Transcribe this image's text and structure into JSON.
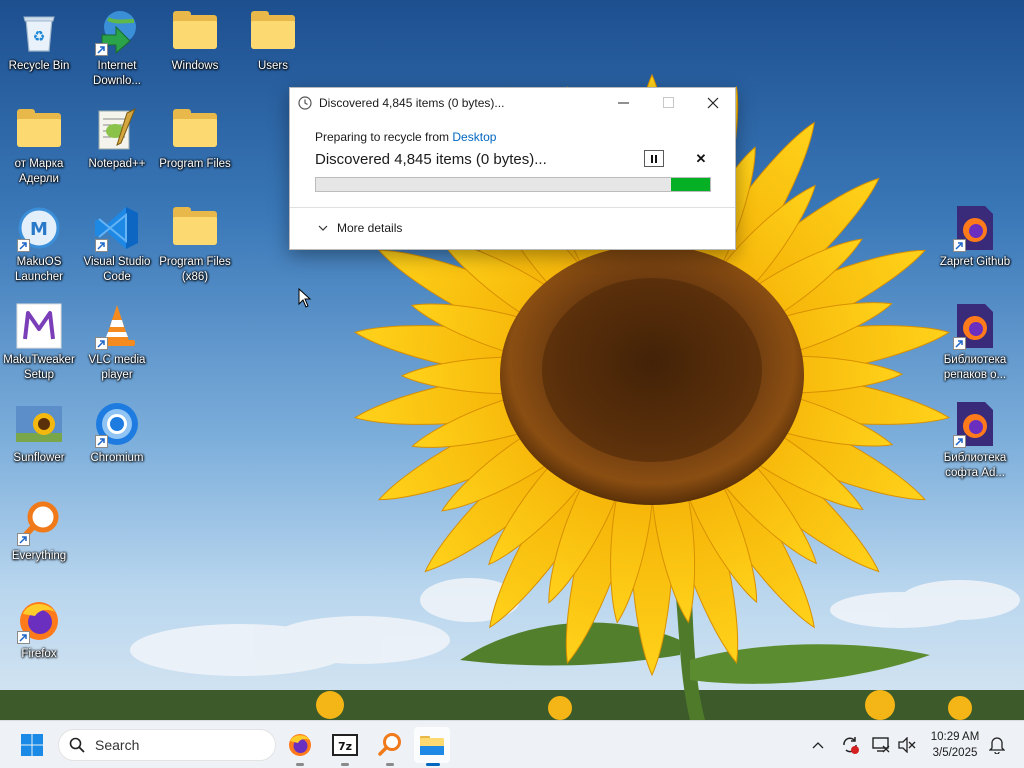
{
  "desktop": {
    "icons": [
      {
        "label": "Recycle Bin",
        "icon": "recycle-bin-icon"
      },
      {
        "label": "Internet Downlo...",
        "icon": "internet-download-manager-icon"
      },
      {
        "label": "Windows",
        "icon": "folder-icon"
      },
      {
        "label": "Users",
        "icon": "folder-icon"
      },
      {
        "label": "от Марка Адерли",
        "icon": "folder-icon"
      },
      {
        "label": "Notepad++",
        "icon": "notepad-plus-plus-icon"
      },
      {
        "label": "Program Files",
        "icon": "folder-icon"
      },
      {
        "label": "MakuOS Launcher",
        "icon": "makuos-launcher-icon"
      },
      {
        "label": "Visual Studio Code",
        "icon": "vscode-icon"
      },
      {
        "label": "Program Files (x86)",
        "icon": "folder-icon"
      },
      {
        "label": "MakuTweaker Setup",
        "icon": "makutweaker-icon"
      },
      {
        "label": "VLC media player",
        "icon": "vlc-icon"
      },
      {
        "label": "Sunflower",
        "icon": "image-thumbnail-icon"
      },
      {
        "label": "Chromium",
        "icon": "chromium-icon"
      },
      {
        "label": "Everything",
        "icon": "everything-search-icon"
      },
      {
        "label": "Firefox",
        "icon": "firefox-icon"
      },
      {
        "label": "Zapret Github",
        "icon": "firefox-shortcut-icon"
      },
      {
        "label": "Библиотека репаков о...",
        "icon": "firefox-shortcut-icon"
      },
      {
        "label": "Библиотека софта Ad...",
        "icon": "firefox-shortcut-icon"
      }
    ]
  },
  "dialog": {
    "title": "Discovered 4,845 items (0 bytes)...",
    "preparing_prefix": "Preparing to recycle from ",
    "preparing_location": "Desktop",
    "status": "Discovered 4,845 items (0 bytes)...",
    "progress_fraction": 0.1,
    "more_details": "More details"
  },
  "taskbar": {
    "search_placeholder": "Search",
    "pinned": [
      "firefox-icon",
      "7zip-icon",
      "everything-search-icon",
      "file-explorer-icon"
    ],
    "active_app": "file-explorer-icon",
    "time": "10:29 AM",
    "date": "3/5/2025"
  },
  "colors": {
    "accent": "#0067c0",
    "progress_green": "#06b025",
    "taskbar_bg": "#eef1f6"
  }
}
